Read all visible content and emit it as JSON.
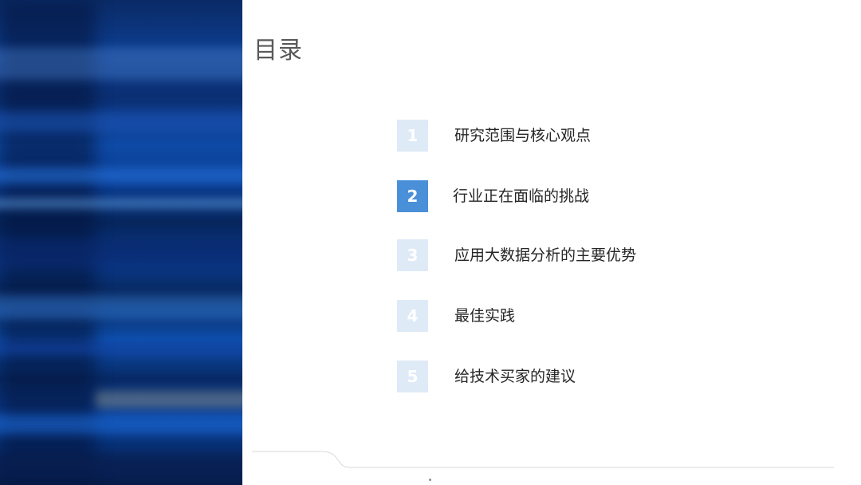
{
  "title": "目录",
  "toc": {
    "items": [
      {
        "num": "1",
        "label": "研究范围与核心观点"
      },
      {
        "num": "2",
        "label": "行业正在面临的挑战"
      },
      {
        "num": "3",
        "label": "应用大数据分析的主要优势"
      },
      {
        "num": "4",
        "label": "最佳实践"
      },
      {
        "num": "5",
        "label": "给技术买家的建议"
      }
    ],
    "active_index": 2
  },
  "colors": {
    "accent": "#4a90d9",
    "inactive_badge": "#dfeaf7",
    "title": "#595959",
    "text": "#262626"
  }
}
